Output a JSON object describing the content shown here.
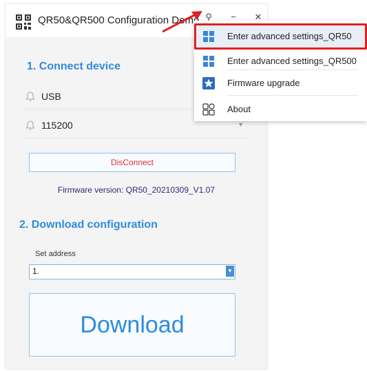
{
  "window": {
    "title": "QR50&QR500 Configuration Demo",
    "pin_glyph": "⚲",
    "minimize_glyph": "−",
    "close_glyph": "✕"
  },
  "connect": {
    "section_title": "1. Connect device",
    "port_label": "USB",
    "baud_label": "115200",
    "disconnect_label": "DisConnect",
    "firmware_text": "Firmware version: QR50_20210309_V1.07"
  },
  "download": {
    "section_title": "2. Download configuration",
    "set_address_label": "Set address",
    "address_value": "1.",
    "download_label": "Download"
  },
  "menu": {
    "items": [
      {
        "label": "Enter advanced settings_QR50",
        "icon": "grid-icon"
      },
      {
        "label": "Enter advanced settings_QR500",
        "icon": "grid-icon"
      },
      {
        "label": "Firmware upgrade",
        "icon": "star-badge-icon"
      },
      {
        "label": "About",
        "icon": "apps-icon"
      }
    ]
  },
  "colors": {
    "accent_blue": "#2e8be0",
    "highlight_red": "#e02020",
    "disconnect_red": "#e03131"
  }
}
